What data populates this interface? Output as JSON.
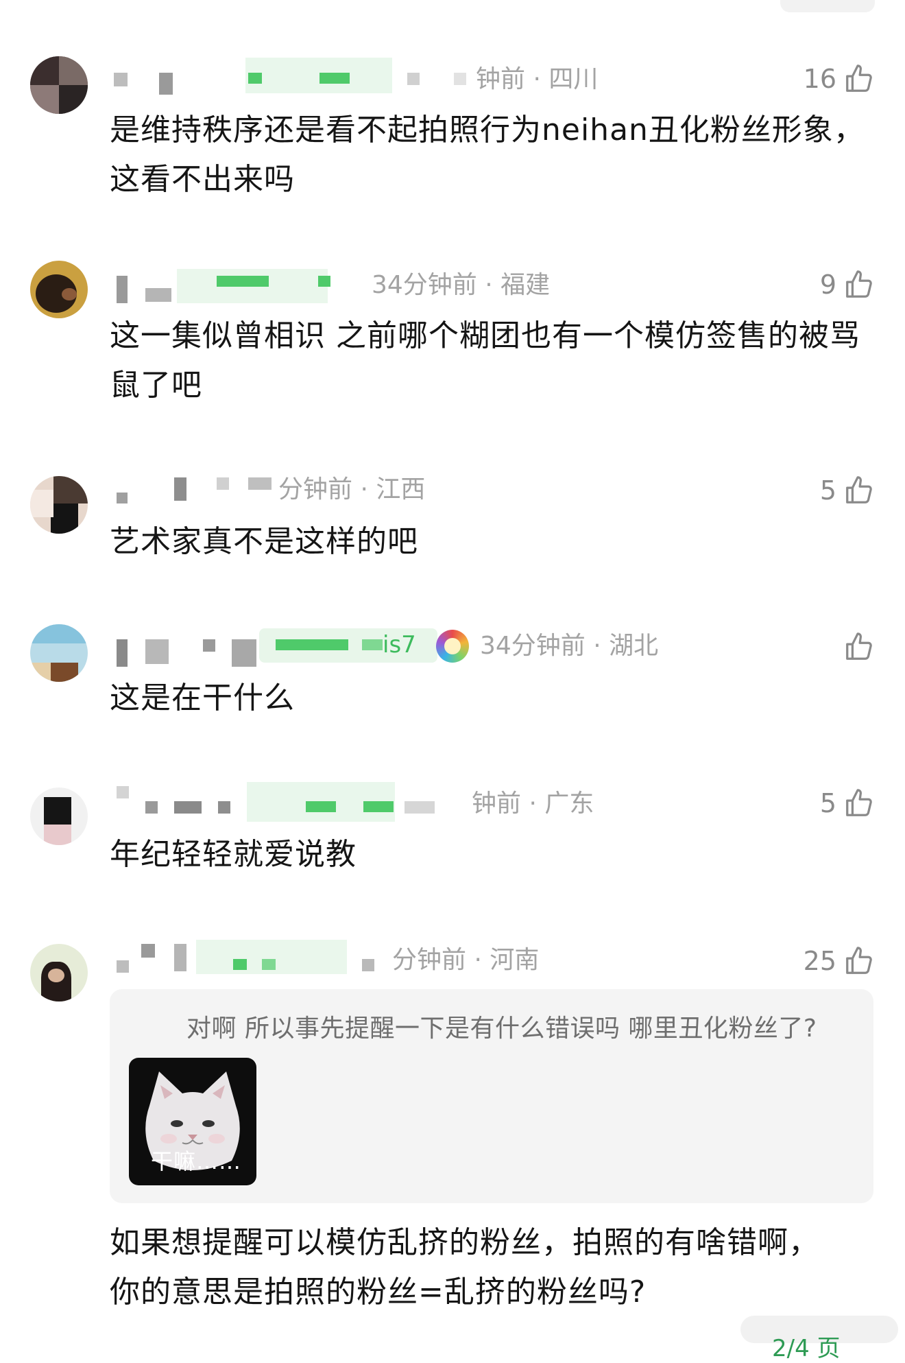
{
  "comments": [
    {
      "time_location": "钟前 · 四川",
      "likes": "16",
      "text": "是维持秩序还是看不起拍照行为neihan丑化粉丝形象，这看不出来吗"
    },
    {
      "time_location": "34分钟前 · 福建",
      "likes": "9",
      "text": "这一集似曾相识 之前哪个糊团也有一个模仿签售的被骂鼠了吧"
    },
    {
      "time_location": "分钟前 · 江西",
      "likes": "5",
      "text": "艺术家真不是这样的吧"
    },
    {
      "name_suffix": "is7",
      "time_location": "34分钟前 · 湖北",
      "likes": "",
      "text": "这是在干什么"
    },
    {
      "time_location": "钟前 · 广东",
      "likes": "5",
      "text": "年纪轻轻就爱说教"
    },
    {
      "time_location": "分钟前 · 河南",
      "likes": "25",
      "text": "如果想提醒可以模仿乱挤的粉丝，拍照的有啥错啊，你的意思是拍照的粉丝=乱挤的粉丝吗?",
      "quote": {
        "text": "对啊 所以事先提醒一下是有什么错误吗 哪里丑化粉丝了?",
        "sticker_caption": "干嘛……"
      }
    }
  ],
  "page_indicator": "2/4 页",
  "icons": {
    "like": "thumbs-up-icon"
  },
  "colors": {
    "accent": "#3dbb5d",
    "meta": "#a3a3a3"
  }
}
